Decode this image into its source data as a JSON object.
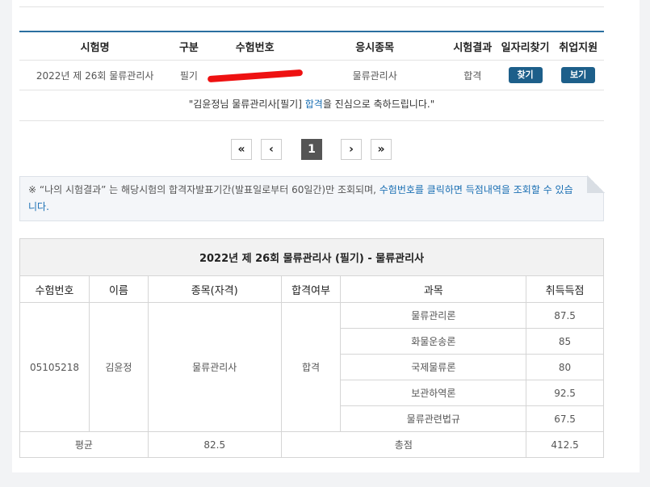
{
  "results": {
    "headers": [
      "시험명",
      "구분",
      "수험번호",
      "응시종목",
      "시험결과",
      "일자리찾기",
      "취업지원"
    ],
    "row": {
      "exam_name": "2022년 제 26회 물류관리사",
      "category": "필기",
      "field": "물류관리사",
      "result": "합격",
      "find_btn": "찾기",
      "view_btn": "보기"
    }
  },
  "congrats": {
    "prefix": "\"김윤정님 물류관리사[필기] ",
    "highlight": "합격",
    "suffix": "을 진심으로 축하드립니다.\""
  },
  "pager": {
    "first": "«",
    "prev": "‹",
    "page": "1",
    "next": "›",
    "last": "»"
  },
  "notice": {
    "mark": "※",
    "text": " “나의 시험결과” 는 해당시험의 합격자발표기간(발표일로부터 60일간)만 조회되며, ",
    "link_text": "수험번호를 클릭하면 득점내역을 조회할 수 있습니다."
  },
  "detail": {
    "caption": "2022년 제 26회 물류관리사 (필기) - 물류관리사",
    "headers": [
      "수험번호",
      "이름",
      "종목(자격)",
      "합격여부",
      "과목",
      "취득득점"
    ],
    "exam_no": "05105218",
    "name": "김윤정",
    "qualification": "물류관리사",
    "pass": "합격",
    "subjects": [
      {
        "name": "물류관리론",
        "score": "87.5"
      },
      {
        "name": "화물운송론",
        "score": "85"
      },
      {
        "name": "국제물류론",
        "score": "80"
      },
      {
        "name": "보관하역론",
        "score": "92.5"
      },
      {
        "name": "물류관련법규",
        "score": "67.5"
      }
    ],
    "average_label": "평균",
    "average": "82.5",
    "total_label": "총점",
    "total": "412.5"
  }
}
